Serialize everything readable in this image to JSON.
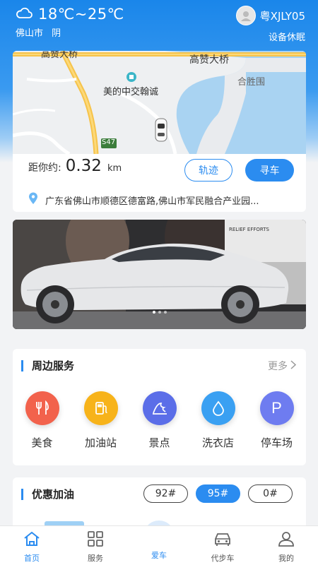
{
  "weather": {
    "temp": "18℃~25℃",
    "city": "佛山市",
    "condition": "阴",
    "icon": "cloud-icon"
  },
  "user": {
    "plate": "粤XJLY05",
    "status": "设备休眠"
  },
  "map": {
    "labels": {
      "bridge_top": "高赞大桥",
      "bridge_main": "高赞大桥",
      "poi": "美的中交翰诚",
      "district": "合胜围",
      "road": "S47"
    }
  },
  "location": {
    "distance_label": "距你约:",
    "distance_value": "0.32",
    "distance_unit": "km",
    "track_label": "轨迹",
    "find_label": "寻车",
    "address": "广东省佛山市顺德区德富路,佛山市军民融合产业园..."
  },
  "banner": {
    "sign_text": "RELIEF EFFORTS",
    "slides": 3,
    "active_slide": 1
  },
  "services": {
    "title": "周边服务",
    "more": "更多",
    "items": [
      {
        "label": "美食",
        "icon": "food-icon",
        "color": "#f2624c"
      },
      {
        "label": "加油站",
        "icon": "gas-station-icon",
        "color": "#f7b31a"
      },
      {
        "label": "景点",
        "icon": "landmark-icon",
        "color": "#5b6ee8"
      },
      {
        "label": "洗衣店",
        "icon": "water-drop-icon",
        "color": "#3aa0f2"
      },
      {
        "label": "停车场",
        "icon": "parking-icon",
        "color": "#6e7cf0"
      }
    ]
  },
  "fuel": {
    "title": "优惠加油",
    "options": [
      "92#",
      "95#",
      "0#"
    ],
    "selected": "95#"
  },
  "tabs": [
    {
      "label": "首页",
      "icon": "home-icon"
    },
    {
      "label": "服务",
      "icon": "grid-icon"
    },
    {
      "label": "爱车",
      "icon": "globe-icon"
    },
    {
      "label": "代步车",
      "icon": "car-icon"
    },
    {
      "label": "我的",
      "icon": "user-icon"
    }
  ],
  "colors": {
    "primary": "#2b8cf0",
    "background": "#f2f3f5"
  }
}
